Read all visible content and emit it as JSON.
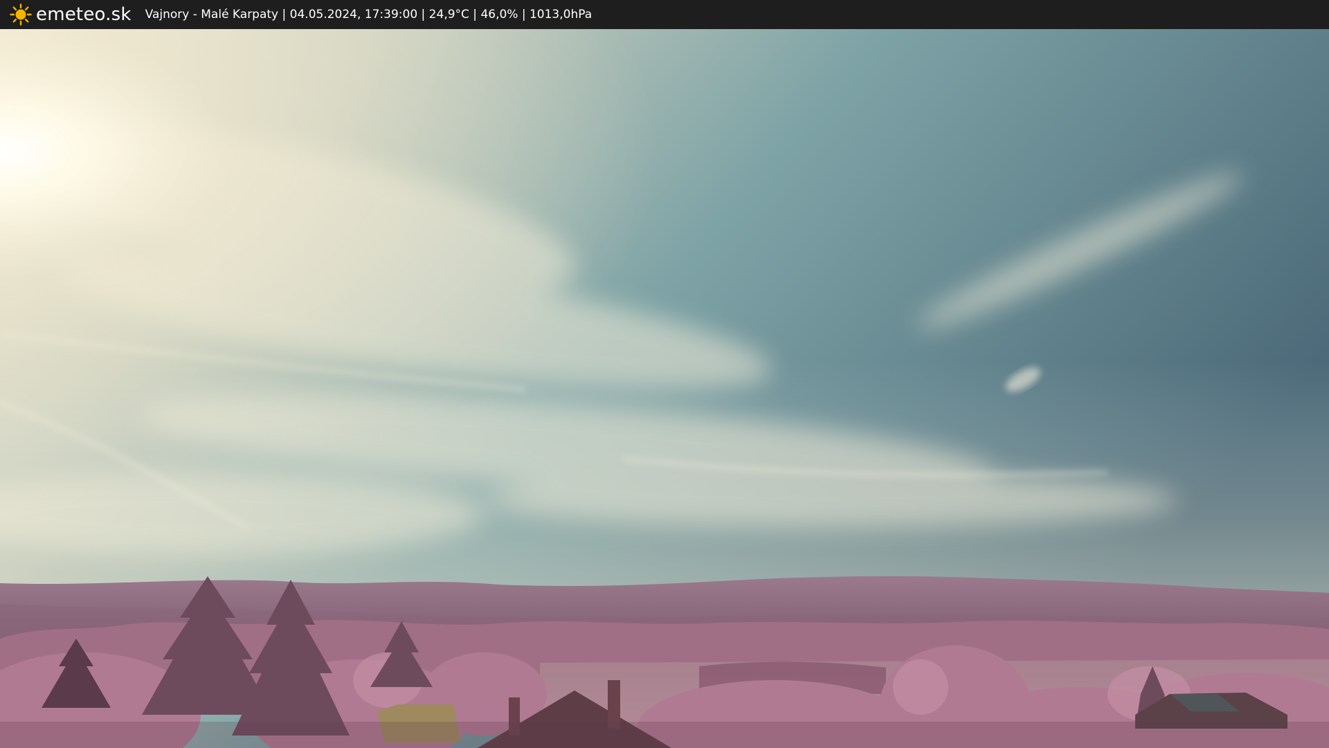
{
  "header": {
    "brand": "emeteo.sk",
    "caption": "Vajnory - Malé Karpaty | 04.05.2024, 17:39:00 | 24,9°C | 46,0% | 1013,0hPa",
    "logo_icon": "sun-icon",
    "logo_color": "#f5b400",
    "bar_color": "#1e1e1e"
  },
  "scene": {
    "sky_colors": [
      "#f4ecd2",
      "#b9c7bb",
      "#6f9aa3",
      "#4d6c7b"
    ],
    "hills_color": "#8c6a7e",
    "foliage_color": "#b07a92"
  }
}
